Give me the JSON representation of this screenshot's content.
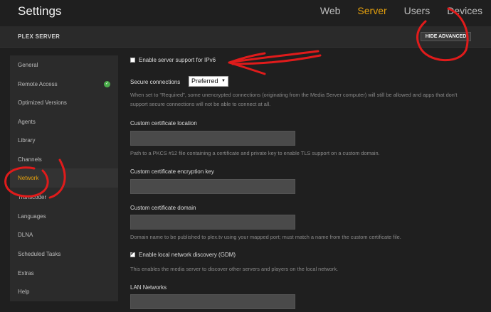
{
  "header": {
    "title": "Settings",
    "nav": [
      {
        "label": "Web",
        "active": false
      },
      {
        "label": "Server",
        "active": true
      },
      {
        "label": "Users",
        "active": false
      },
      {
        "label": "Devices",
        "active": false
      }
    ]
  },
  "server_bar": {
    "label": "PLEX SERVER",
    "hide_advanced": "HIDE ADVANCED"
  },
  "sidebar": {
    "items": [
      {
        "label": "General"
      },
      {
        "label": "Remote Access",
        "status": "ok"
      },
      {
        "label": "Optimized Versions"
      },
      {
        "label": "Agents"
      },
      {
        "label": "Library"
      },
      {
        "label": "Channels"
      },
      {
        "label": "Network",
        "active": true
      },
      {
        "label": "Transcoder"
      },
      {
        "label": "Languages"
      },
      {
        "label": "DLNA"
      },
      {
        "label": "Scheduled Tasks"
      },
      {
        "label": "Extras"
      },
      {
        "label": "Help"
      }
    ]
  },
  "main": {
    "ipv6": {
      "label": "Enable server support for IPv6",
      "checked": false
    },
    "secure": {
      "label": "Secure connections",
      "value": "Preferred",
      "help": "When set to \"Required\", some unencrypted connections (originating from the Media Server computer) will still be allowed and apps that don't support secure connections will not be able to connect at all."
    },
    "cert_location": {
      "label": "Custom certificate location",
      "value": "",
      "help": "Path to a PKCS #12 file containing a certificate and private key to enable TLS support on a custom domain."
    },
    "cert_key": {
      "label": "Custom certificate encryption key",
      "value": ""
    },
    "cert_domain": {
      "label": "Custom certificate domain",
      "value": "",
      "help": "Domain name to be published to plex.tv using your mapped port; must match a name from the custom certificate file."
    },
    "gdm": {
      "label": "Enable local network discovery (GDM)",
      "checked": true,
      "help": "This enables the media server to discover other servers and players on the local network."
    },
    "lan": {
      "label": "LAN Networks",
      "value": ""
    }
  },
  "colors": {
    "accent": "#e5a00d",
    "annotation": "#e01b1b",
    "ok": "#4cae4c"
  }
}
